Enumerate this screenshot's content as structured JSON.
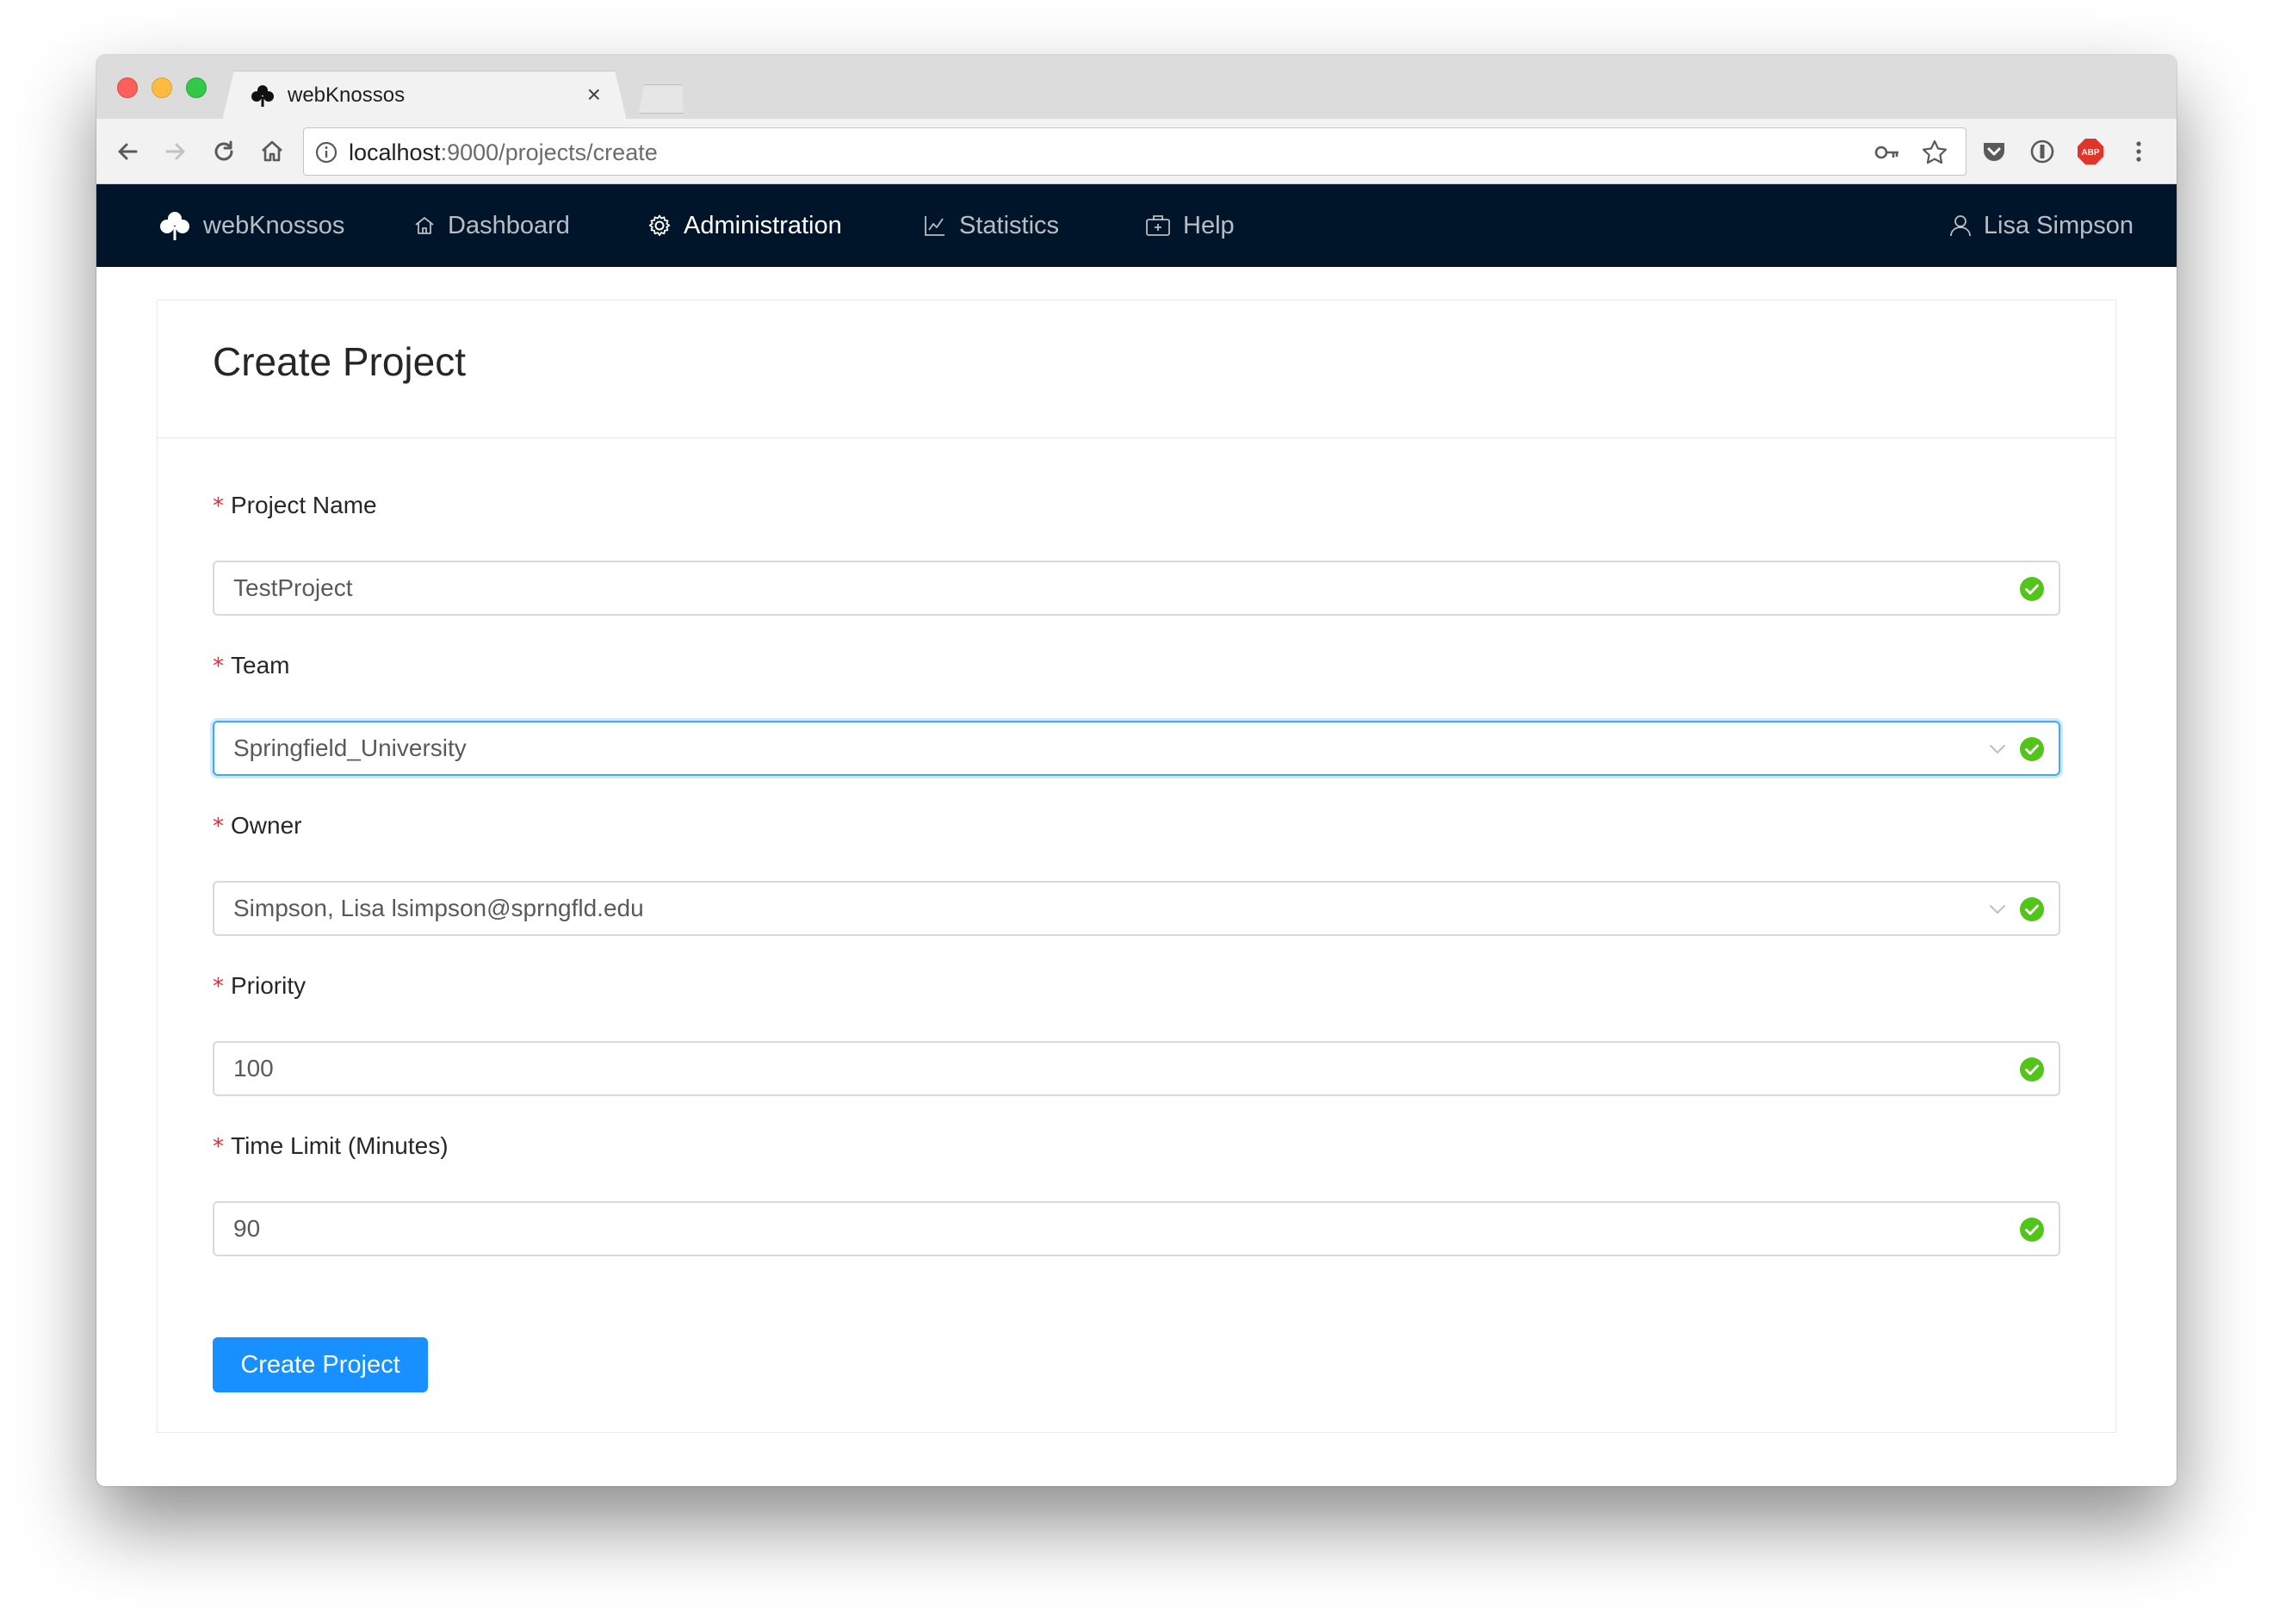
{
  "browser": {
    "tab_title": "webKnossos",
    "url_host": "localhost",
    "url_path": ":9000/projects/create"
  },
  "nav": {
    "brand": "webKnossos",
    "items": [
      {
        "label": "Dashboard",
        "icon": "home-icon"
      },
      {
        "label": "Administration",
        "icon": "gear-icon",
        "active": true
      },
      {
        "label": "Statistics",
        "icon": "line-chart-icon"
      },
      {
        "label": "Help",
        "icon": "medicine-box-icon"
      }
    ],
    "user": "Lisa Simpson"
  },
  "form": {
    "title": "Create Project",
    "fields": [
      {
        "label": "Project Name",
        "value": "TestProject",
        "type": "text",
        "required_mark": "*"
      },
      {
        "label": "Team",
        "value": "Springfield_University",
        "type": "select",
        "required_mark": "*"
      },
      {
        "label": "Owner",
        "value": "Simpson, Lisa lsimpson@sprngfld.edu",
        "type": "select",
        "required_mark": "*"
      },
      {
        "label": "Priority",
        "value": "100",
        "type": "number",
        "required_mark": "*"
      },
      {
        "label": "Time Limit (Minutes)",
        "value": "90",
        "type": "number",
        "required_mark": "*"
      }
    ],
    "submit_label": "Create Project"
  },
  "colors": {
    "nav_bg": "#001529",
    "primary": "#1890ff",
    "success": "#52c41a",
    "required": "#f5222d"
  }
}
